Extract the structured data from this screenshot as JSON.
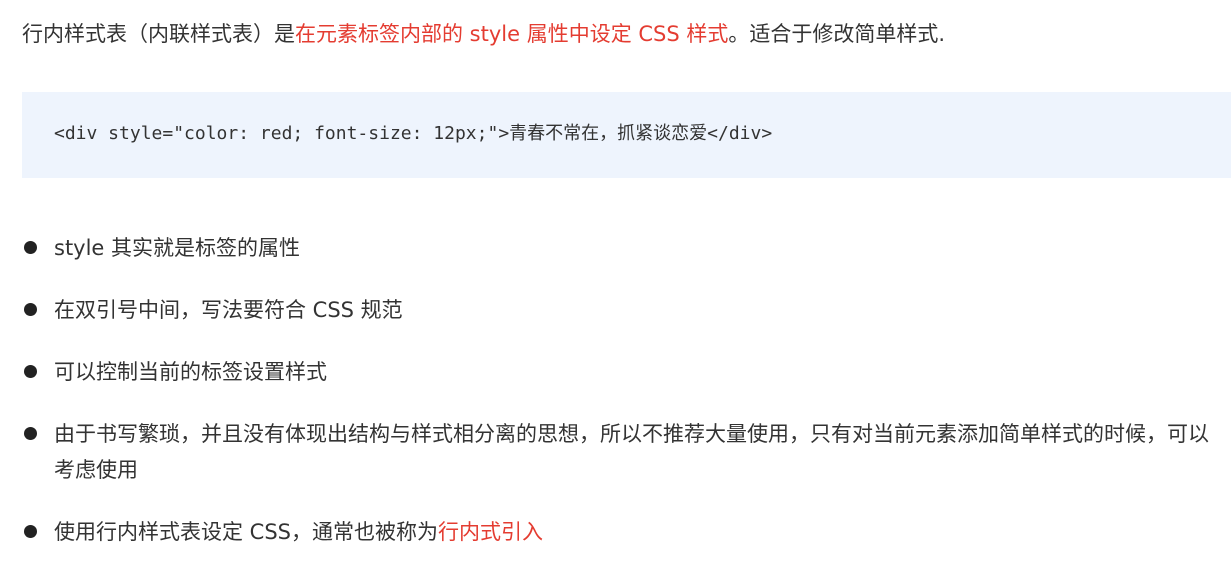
{
  "intro": {
    "prefix": "行内样式表（内联样式表）是",
    "highlight": "在元素标签内部的 style 属性中设定 CSS 样式",
    "suffix": "。适合于修改简单样式."
  },
  "code": {
    "line": "<div style=\"color: red; font-size: 12px;\">青春不常在，抓紧谈恋爱</div>"
  },
  "bullets": [
    {
      "text": "style 其实就是标签的属性"
    },
    {
      "text": "在双引号中间，写法要符合 CSS 规范"
    },
    {
      "text": "可以控制当前的标签设置样式"
    },
    {
      "text": "由于书写繁琐，并且没有体现出结构与样式相分离的思想，所以不推荐大量使用，只有对当前元素添加简单样式的时候，可以考虑使用"
    },
    {
      "text": "使用行内样式表设定 CSS，通常也被称为",
      "highlight": "行内式引入"
    }
  ],
  "colors": {
    "accent_red": "#e43c31",
    "code_background": "#eef4fd",
    "text": "#333333"
  }
}
